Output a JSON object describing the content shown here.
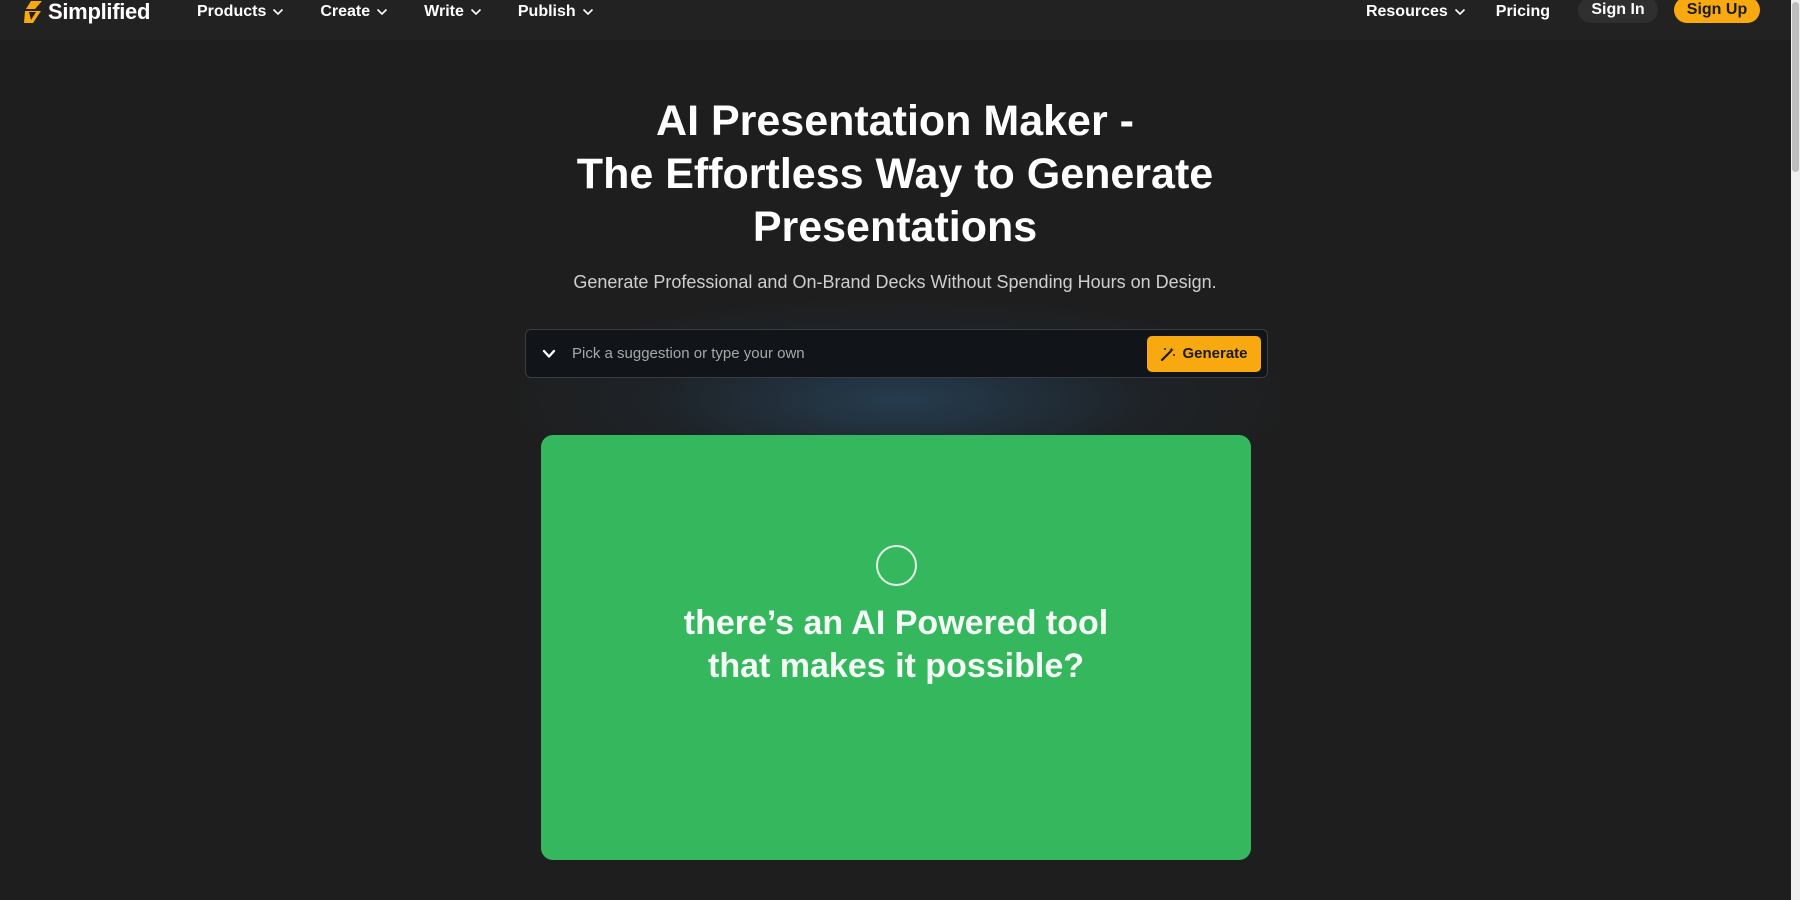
{
  "nav": {
    "brand": "Simplified",
    "left_items": [
      {
        "label": "Products",
        "has_dropdown": true
      },
      {
        "label": "Create",
        "has_dropdown": true
      },
      {
        "label": "Write",
        "has_dropdown": true
      },
      {
        "label": "Publish",
        "has_dropdown": true
      }
    ],
    "resources": "Resources",
    "pricing": "Pricing",
    "sign_in": "Sign In",
    "sign_up": "Sign Up"
  },
  "hero": {
    "title_line1": "AI Presentation Maker -",
    "title_line2": "The Effortless Way to Generate",
    "title_line3": "Presentations",
    "subtitle": "Generate Professional and On-Brand Decks Without Spending Hours on Design."
  },
  "prompt": {
    "placeholder": "Pick a suggestion or type your own",
    "value": "",
    "generate_label": "Generate"
  },
  "video": {
    "caption_line1": "there’s an AI Powered tool",
    "caption_line2": "that makes it possible?"
  },
  "colors": {
    "background": "#1e1e1e",
    "navbar": "#222222",
    "accent": "#f7a90f",
    "video_green": "#35b75d"
  },
  "icons": {
    "logo": "simplified-logo-icon",
    "dropdown": "chevron-down-icon",
    "generate": "magic-wand-icon",
    "video": "circle-icon"
  }
}
